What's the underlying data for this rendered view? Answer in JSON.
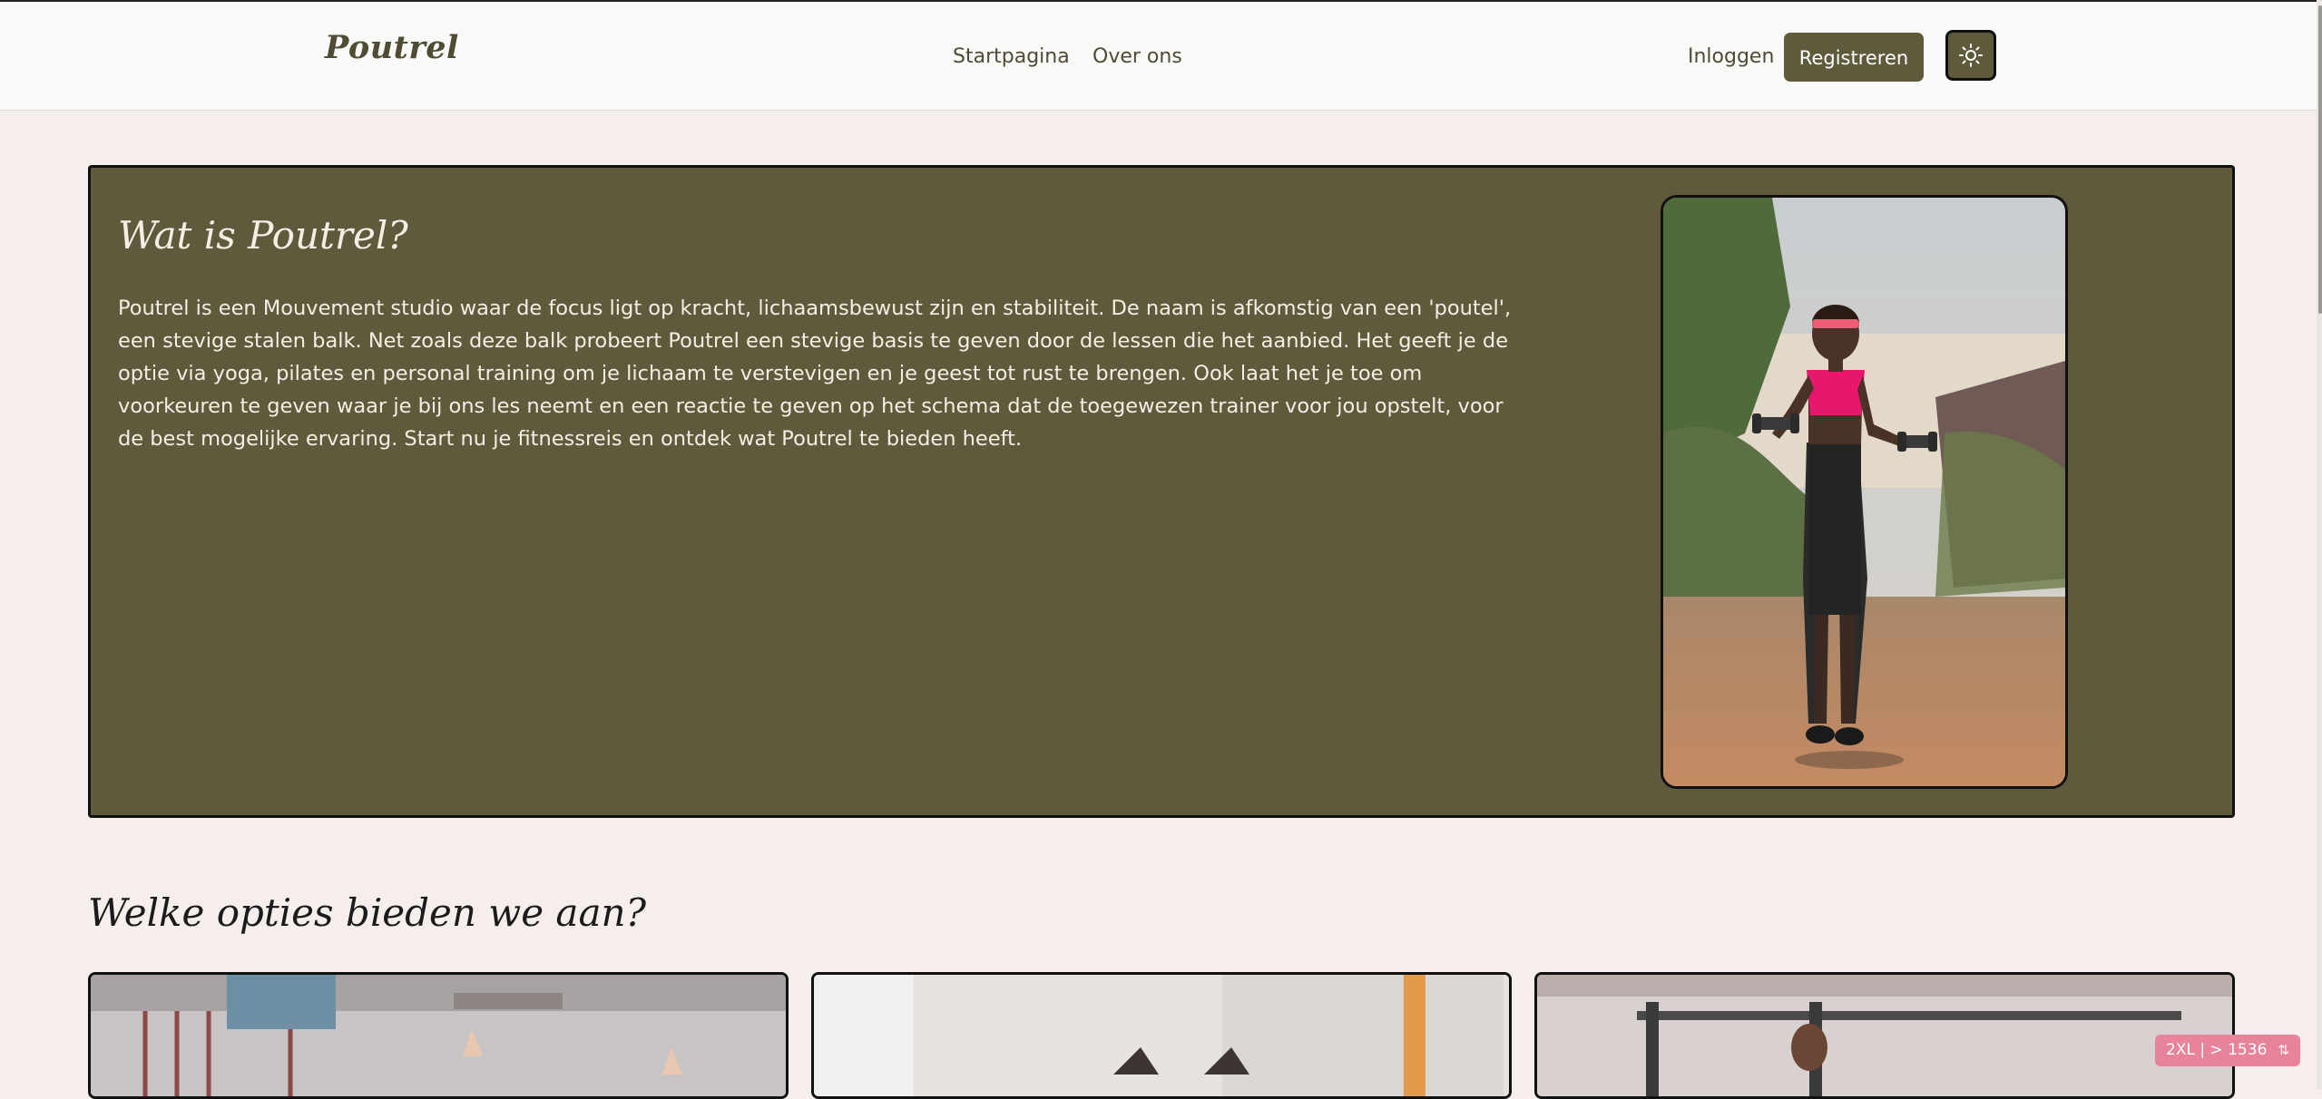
{
  "header": {
    "brand": "Poutrel",
    "nav": [
      {
        "label": "Startpagina"
      },
      {
        "label": "Over ons"
      }
    ],
    "login_label": "Inloggen",
    "register_label": "Registreren"
  },
  "hero": {
    "title": "Wat is Poutrel?",
    "body": "Poutrel is een Mouvement studio waar de focus ligt op kracht, lichaamsbewust zijn en stabiliteit. De naam is afkomstig van een 'poutel', een stevige stalen balk. Net zoals deze balk probeert Poutrel een stevige basis te geven door de lessen die het aanbied. Het geeft je de optie via yoga, pilates en personal training om je lichaam te verstevigen en je geest tot rust te brengen. Ook laat het je toe om voorkeuren te geven waar je bij ons les neemt en een reactie te geven op het schema dat de toegewezen trainer voor jou opstelt, voor de best mogelijke ervaring. Start nu je fitnessreis en ontdek wat Poutrel te bieden heeft."
  },
  "options": {
    "title": "Welke opties bieden we aan?"
  },
  "breakpoint_badge": "2XL | > 1536",
  "colors": {
    "accent": "#5e5a3b",
    "page_background": "#f6eeec",
    "badge": "#e7849c"
  }
}
